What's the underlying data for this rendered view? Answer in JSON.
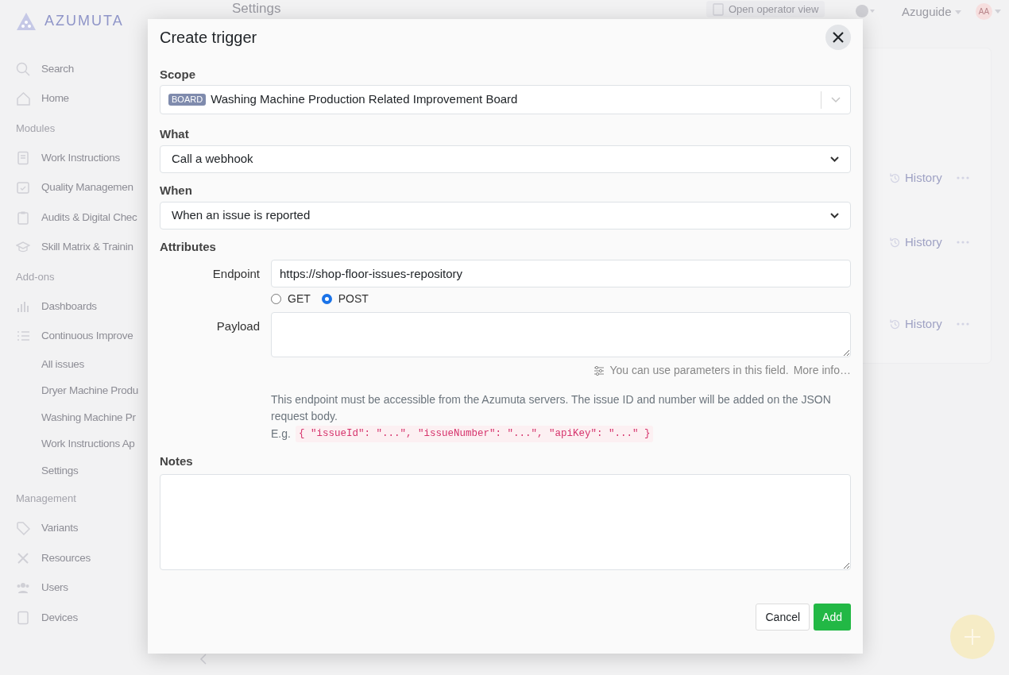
{
  "background": {
    "logo": "AZUMUTA",
    "page_title": "Settings",
    "operator_button": "Open operator view",
    "user_menu": "Azuguide",
    "avatar": "AA",
    "sidebar": [
      {
        "kind": "item",
        "label": "Search"
      },
      {
        "kind": "item",
        "label": "Home"
      },
      {
        "kind": "heading",
        "label": "Modules"
      },
      {
        "kind": "item",
        "label": "Work Instructions"
      },
      {
        "kind": "item",
        "label": "Quality Managemen"
      },
      {
        "kind": "item",
        "label": "Audits & Digital Chec"
      },
      {
        "kind": "item",
        "label": "Skill Matrix & Trainin"
      },
      {
        "kind": "heading",
        "label": "Add-ons"
      },
      {
        "kind": "item",
        "label": "Dashboards"
      },
      {
        "kind": "item",
        "label": "Continuous Improve"
      },
      {
        "kind": "subitem",
        "label": "All issues"
      },
      {
        "kind": "subitem",
        "label": "Dryer Machine Produ"
      },
      {
        "kind": "subitem",
        "label": "Washing Machine Pr"
      },
      {
        "kind": "subitem",
        "label": "Work Instructions Ap"
      },
      {
        "kind": "subitem",
        "label": "Settings"
      },
      {
        "kind": "heading",
        "label": "Management"
      },
      {
        "kind": "item",
        "label": "Variants"
      },
      {
        "kind": "item",
        "label": "Resources"
      },
      {
        "kind": "item",
        "label": "Users"
      },
      {
        "kind": "item",
        "label": "Devices"
      }
    ],
    "rows": [
      {
        "action": "History"
      },
      {
        "action": "History"
      },
      {
        "action": "History"
      }
    ]
  },
  "dialog": {
    "title": "Create trigger",
    "scope": {
      "label": "Scope",
      "tag": "BOARD",
      "value": "Washing Machine Production Related Improvement Board"
    },
    "what": {
      "label": "What",
      "value": "Call a webhook"
    },
    "when": {
      "label": "When",
      "value": "When an issue is reported"
    },
    "attributes": {
      "heading": "Attributes",
      "endpoint": {
        "label": "Endpoint",
        "value": "https://shop-floor-issues-repository"
      },
      "methods": [
        {
          "label": "GET",
          "selected": false
        },
        {
          "label": "POST",
          "selected": true
        }
      ],
      "payload": {
        "label": "Payload"
      },
      "hint": "You can use parameters in this field.",
      "hint_link": "More info…",
      "description": "This endpoint must be accessible from the Azumuta servers. The issue ID and number will be added on the JSON request body.",
      "example_prefix": "E.g.",
      "example_code": "{ \"issueId\": \"...\", \"issueNumber\": \"...\", \"apiKey\": \"...\" }"
    },
    "notes": {
      "label": "Notes"
    },
    "buttons": [
      {
        "kind": "secondary",
        "label": "Cancel"
      },
      {
        "kind": "primary",
        "label": "Add"
      }
    ]
  }
}
